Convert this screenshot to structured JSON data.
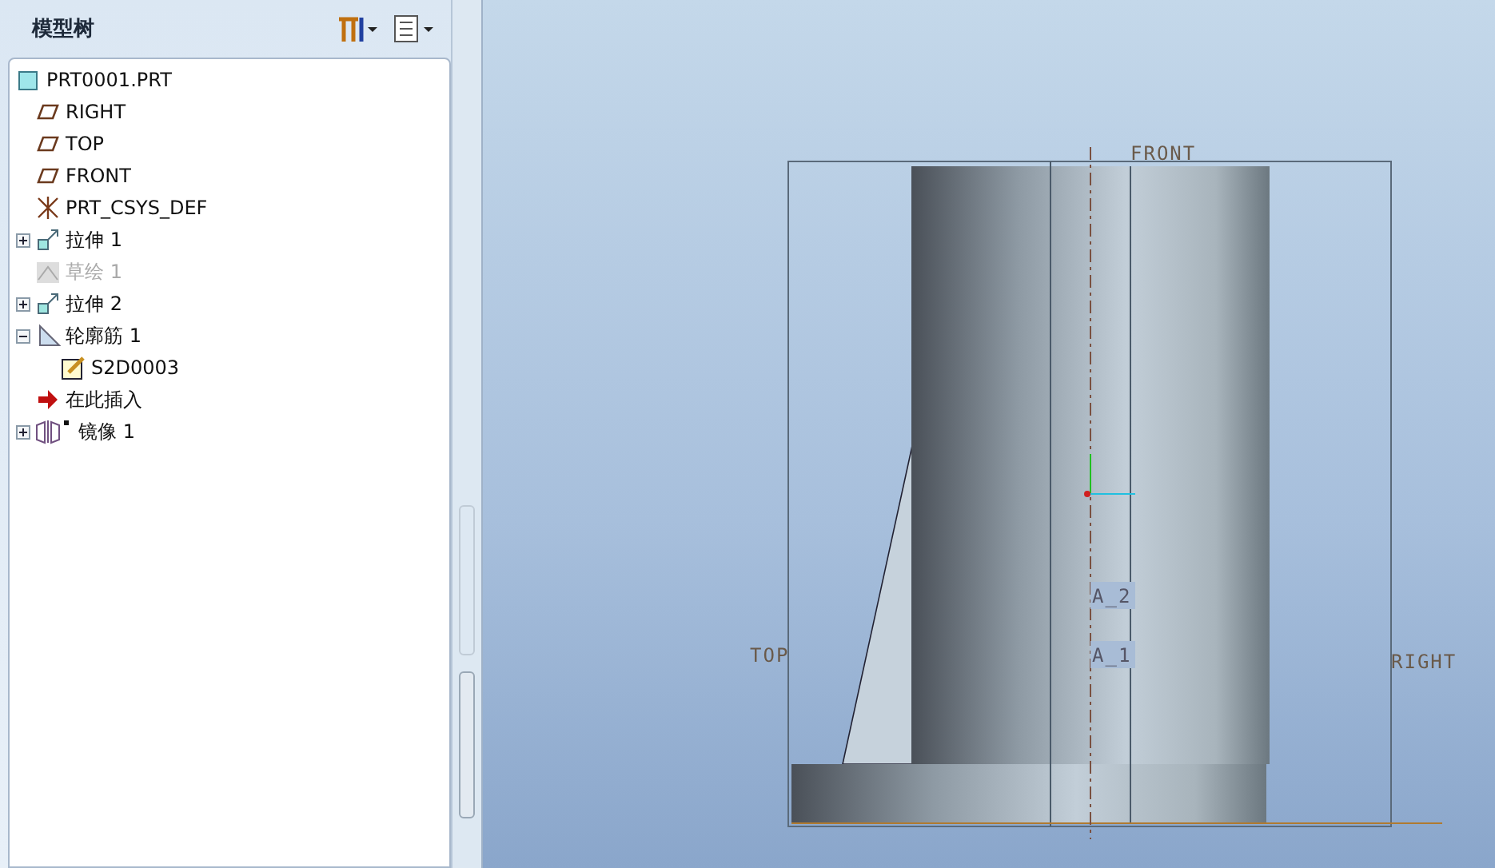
{
  "panel": {
    "title": "模型树"
  },
  "tree": {
    "root": {
      "label": "PRT0001.PRT",
      "kind": "part",
      "children": [
        {
          "label": "RIGHT",
          "kind": "plane",
          "disabled": false
        },
        {
          "label": "TOP",
          "kind": "plane",
          "disabled": false
        },
        {
          "label": "FRONT",
          "kind": "plane",
          "disabled": false
        },
        {
          "label": "PRT_CSYS_DEF",
          "kind": "csys",
          "disabled": false
        },
        {
          "label": "拉伸 1",
          "kind": "extrude",
          "disabled": false,
          "expanded": false
        },
        {
          "label": "草绘 1",
          "kind": "sketch",
          "disabled": true
        },
        {
          "label": "拉伸 2",
          "kind": "extrude",
          "disabled": false,
          "expanded": false
        },
        {
          "label": "轮廓筋 1",
          "kind": "rib",
          "disabled": false,
          "expanded": true,
          "children": [
            {
              "label": "S2D0003",
              "kind": "section",
              "disabled": false
            }
          ]
        },
        {
          "label": "在此插入",
          "kind": "insert",
          "disabled": false
        },
        {
          "label": "镜像 1",
          "kind": "mirror",
          "disabled": false,
          "expanded": false
        }
      ]
    }
  },
  "viewport": {
    "labels": [
      {
        "text": "FRONT",
        "kind": "plane"
      },
      {
        "text": "A_2",
        "kind": "axis"
      },
      {
        "text": "TOP",
        "kind": "plane"
      },
      {
        "text": "A_1",
        "kind": "axis"
      },
      {
        "text": "RIGHT",
        "kind": "plane"
      }
    ]
  }
}
